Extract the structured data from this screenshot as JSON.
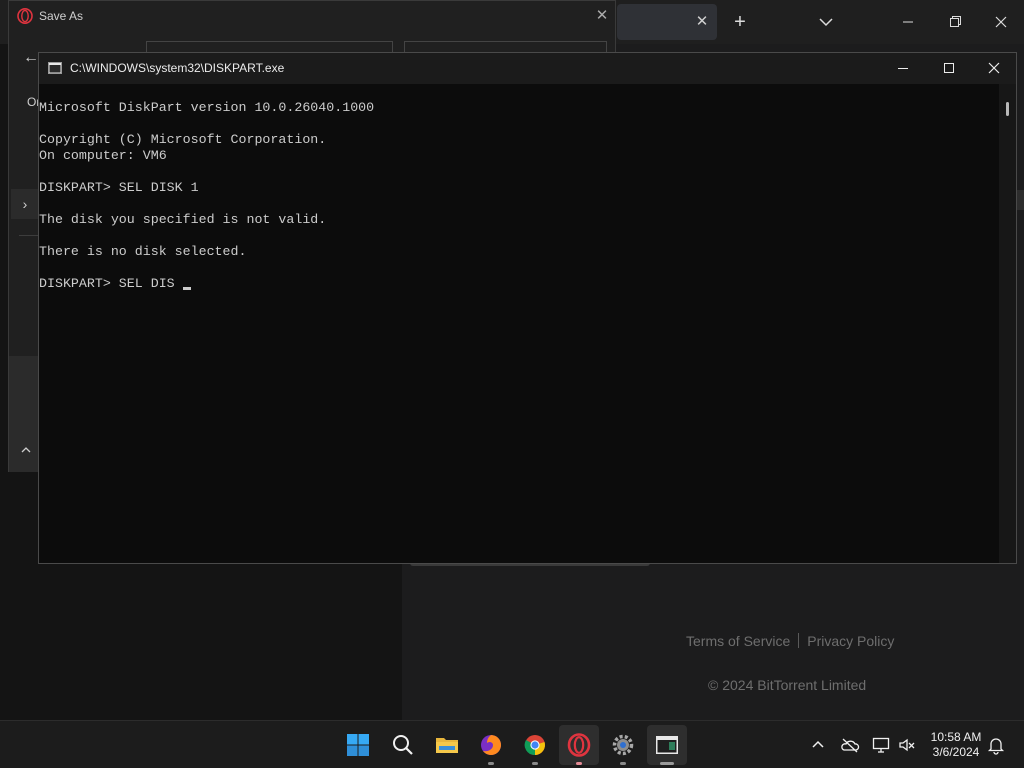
{
  "browser": {
    "footer": {
      "terms_label": "Terms of Service",
      "privacy_label": "Privacy Policy",
      "copyright": "© 2024 BitTorrent Limited"
    }
  },
  "save_dialog": {
    "title": "Save As",
    "organize_label": "Or"
  },
  "console": {
    "title": "C:\\WINDOWS\\system32\\DISKPART.exe",
    "lines": [
      "Microsoft DiskPart version 10.0.26040.1000",
      "",
      "Copyright (C) Microsoft Corporation.",
      "On computer: VM6",
      "",
      "DISKPART> SEL DISK 1",
      "",
      "The disk you specified is not valid.",
      "",
      "There is no disk selected.",
      "",
      "DISKPART> SEL DIS"
    ]
  },
  "taskbar": {
    "apps": [
      {
        "name": "start",
        "icon": "windows-start-icon"
      },
      {
        "name": "search",
        "icon": "search-icon"
      },
      {
        "name": "file-explorer",
        "icon": "folder-icon"
      },
      {
        "name": "firefox",
        "icon": "firefox-icon"
      },
      {
        "name": "chrome",
        "icon": "chrome-icon"
      },
      {
        "name": "opera",
        "icon": "opera-icon"
      },
      {
        "name": "settings",
        "icon": "gear-icon"
      },
      {
        "name": "terminal",
        "icon": "console-window-icon"
      }
    ],
    "clock": {
      "time": "10:58 AM",
      "date": "3/6/2024"
    }
  },
  "colors": {
    "console_bg": "#0c0c0c",
    "console_text": "#cccccc",
    "opera_red": "#e0343f",
    "start_blue": "#36a9f4"
  }
}
